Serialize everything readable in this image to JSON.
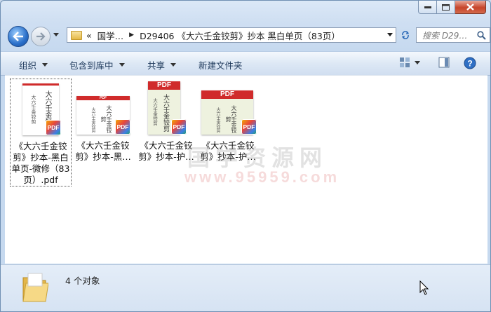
{
  "window": {
    "caption": {
      "minimize": "minimize",
      "maximize": "maximize",
      "close": "close"
    }
  },
  "address": {
    "overflow": "«",
    "crumbs": [
      "国学…",
      "D29406 《大六壬金铰剪》抄本 黑白单页（83页）"
    ],
    "search_placeholder": "搜索 D29…"
  },
  "toolbar": {
    "organize": "组织",
    "include_in_library": "包含到库中",
    "share": "共享",
    "new_folder": "新建文件夹"
  },
  "files": [
    {
      "name": "《大六壬金铰剪》抄本-黑白单页-微修（83页）.pdf",
      "selected": true
    },
    {
      "name": "《大六壬金铰剪》抄本-黑…",
      "selected": false
    },
    {
      "name": "《大六壬金铰剪》抄本-护…",
      "selected": false
    },
    {
      "name": "《大六壬金铰剪》抄本-护…",
      "selected": false
    }
  ],
  "thumbs": {
    "band_label": "PDF",
    "cover_title": "大六壬金铰剪",
    "badge": "PDF"
  },
  "watermark": {
    "line1": "国学资源网",
    "line2": "www.95959.com"
  },
  "status": {
    "count": "4 个对象"
  },
  "colors": {
    "pdf_red": "#d02b2b",
    "toolbar_text": "#1e395b",
    "frame": "#c6d9ef"
  }
}
